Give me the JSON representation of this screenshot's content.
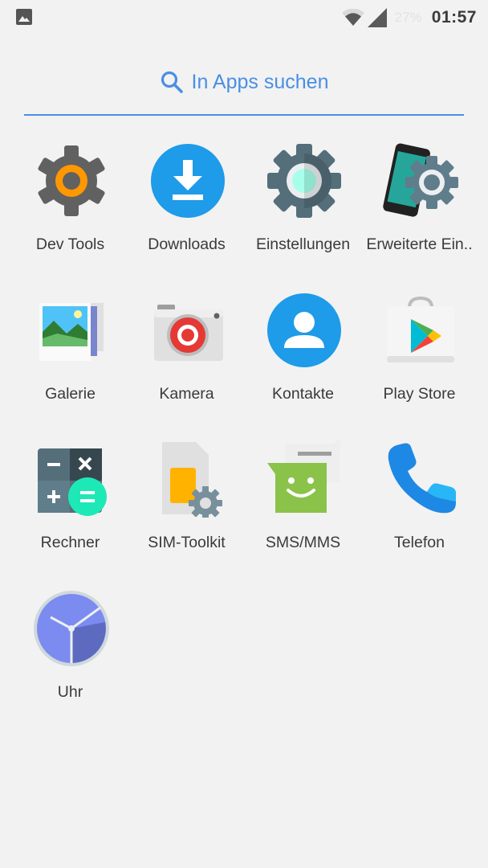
{
  "status_bar": {
    "notification_icon": "gallery-icon",
    "wifi_icon": "wifi-icon",
    "signal_icon": "signal-icon",
    "battery": "27%",
    "time": "01:57"
  },
  "search": {
    "icon": "search-icon",
    "placeholder": "In Apps suchen",
    "accent_color": "#4a8fe3"
  },
  "apps": [
    {
      "label": "Dev Tools",
      "icon": "dev-tools-icon"
    },
    {
      "label": "Downloads",
      "icon": "downloads-icon"
    },
    {
      "label": "Einstellungen",
      "icon": "settings-icon"
    },
    {
      "label": "Erweiterte Ein..",
      "icon": "advanced-settings-icon"
    },
    {
      "label": "Galerie",
      "icon": "gallery-icon"
    },
    {
      "label": "Kamera",
      "icon": "camera-icon"
    },
    {
      "label": "Kontakte",
      "icon": "contacts-icon"
    },
    {
      "label": "Play Store",
      "icon": "play-store-icon"
    },
    {
      "label": "Rechner",
      "icon": "calculator-icon"
    },
    {
      "label": "SIM-Toolkit",
      "icon": "sim-toolkit-icon"
    },
    {
      "label": "SMS/MMS",
      "icon": "messaging-icon"
    },
    {
      "label": "Telefon",
      "icon": "phone-icon"
    },
    {
      "label": "Uhr",
      "icon": "clock-icon"
    }
  ]
}
